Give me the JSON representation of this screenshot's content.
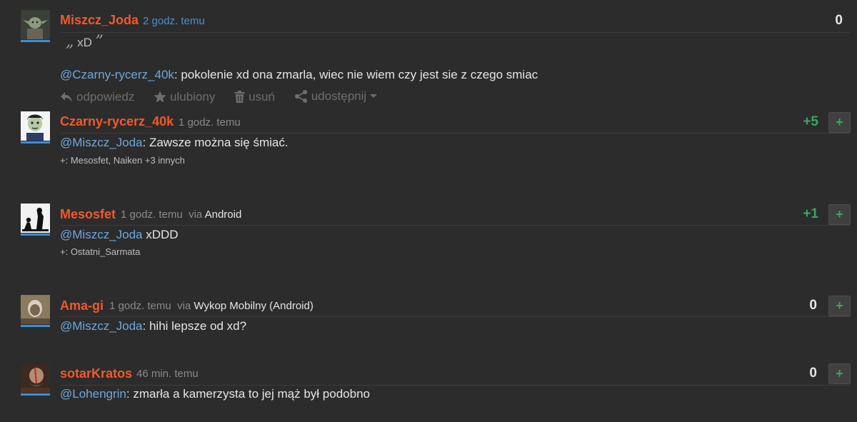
{
  "comments": [
    {
      "author": "Miszcz_Joda",
      "time": "2 godz. temu",
      "score": "0",
      "quote_open": "„",
      "quote_text": "xD",
      "quote_close": "”",
      "mention": "@Czarny-rycerz_40k",
      "text": ": pokolenie xd ona zmarla, wiec nie wiem czy jest sie z czego smiac",
      "actions": {
        "reply": "odpowiedz",
        "favorite": "ulubiony",
        "delete": "usuń",
        "share": "udostępnij"
      }
    },
    {
      "author": "Czarny-rycerz_40k",
      "time": "1 godz. temu",
      "score": "+5",
      "mention": "@Miszcz_Joda",
      "text": ": Zawsze można się śmiać.",
      "voters": "+: Mesosfet, Naiken +3 innych"
    },
    {
      "author": "Mesosfet",
      "time": "1 godz. temu",
      "via_label": "via",
      "via": "Android",
      "score": "+1",
      "mention": "@Miszcz_Joda",
      "text": " xDDD",
      "voters": "+: Ostatni_Sarmata"
    },
    {
      "author": "Ama-gi",
      "time": "1 godz. temu",
      "via_label": "via",
      "via": "Wykop Mobilny (Android)",
      "score": "0",
      "mention": "@Miszcz_Joda",
      "text": ": hihi lepsze od xd?"
    },
    {
      "author": "sotarKratos",
      "time": "46 min. temu",
      "score": "0",
      "mention": "@Lohengrin",
      "text": ": zmarła a kamerzysta to jej mąż był podobno"
    }
  ],
  "plus_label": "+",
  "colors": {
    "background": "#2c2c2c",
    "author": "#f2592a",
    "mention": "#6fa7dd",
    "positive": "#3ca55c",
    "avatar_bar": "#3b8ed6"
  }
}
